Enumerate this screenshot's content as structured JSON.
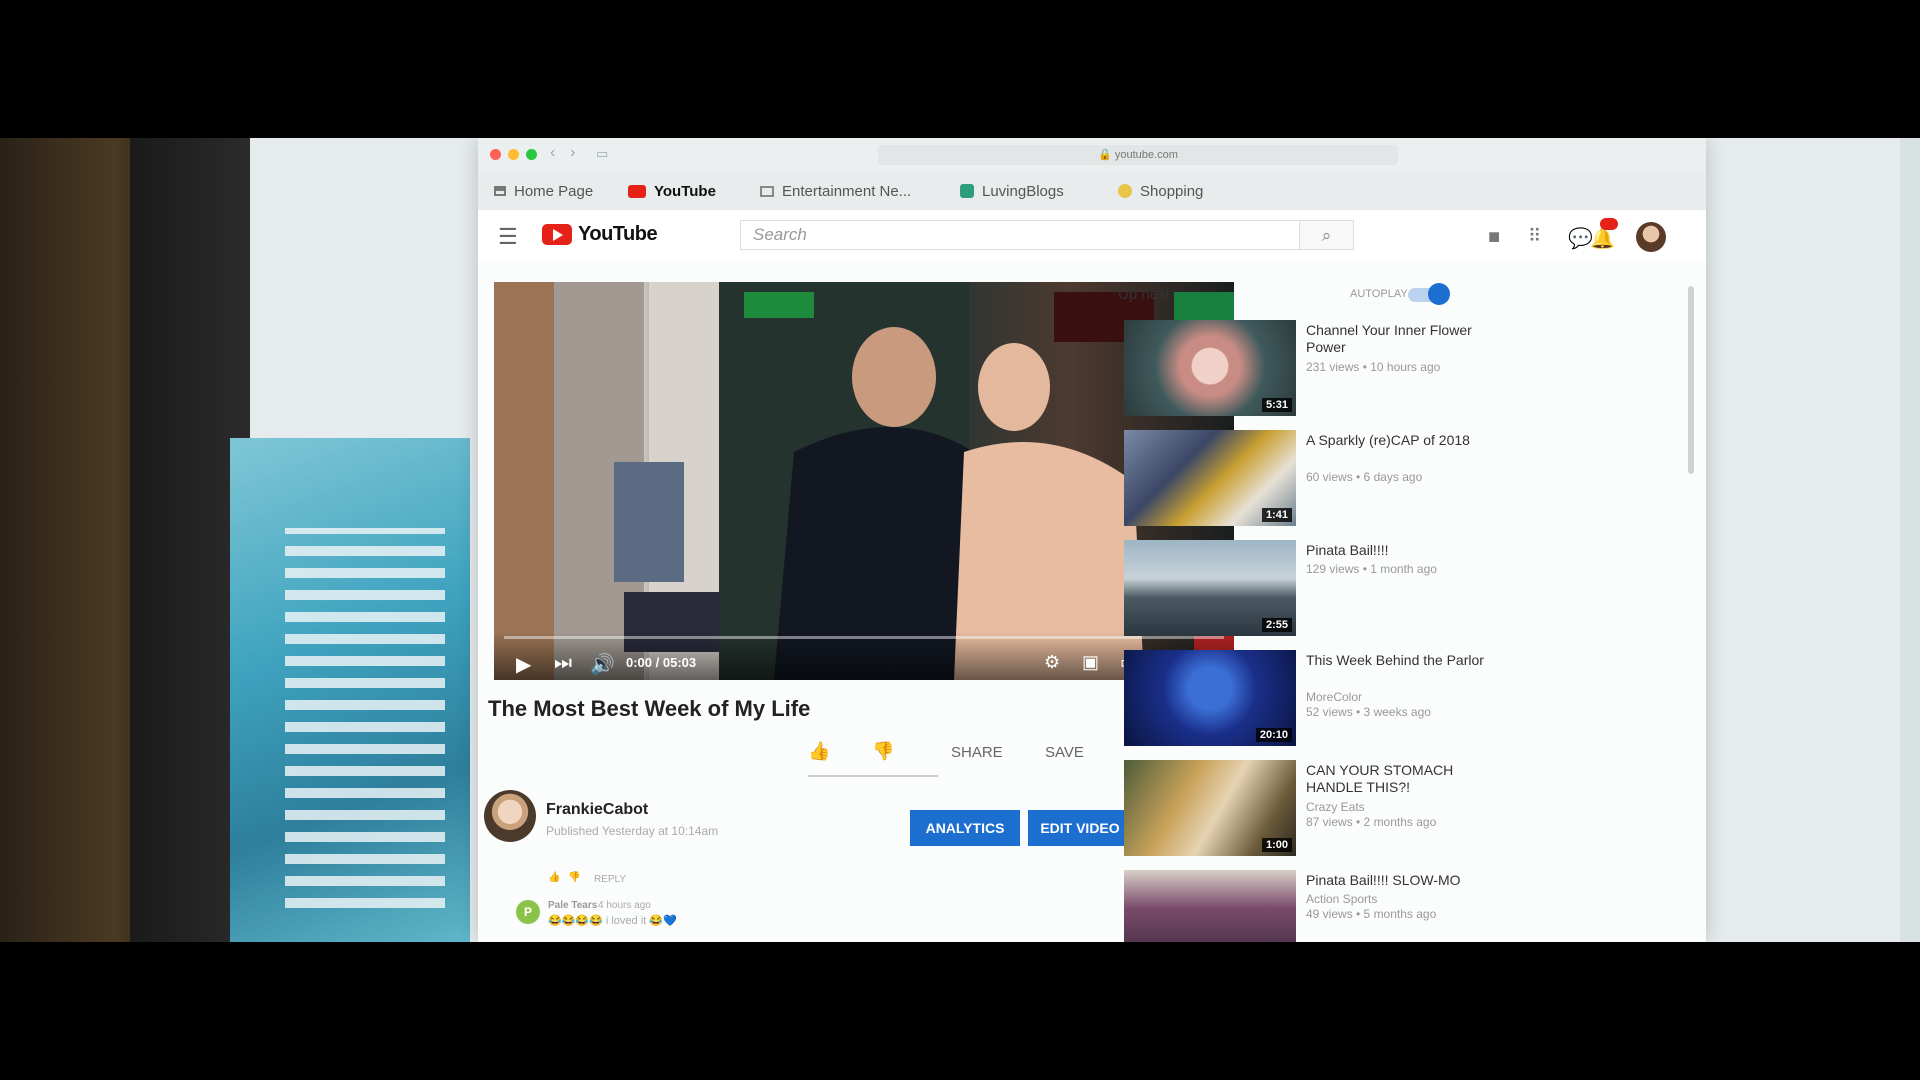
{
  "browser": {
    "url": "youtube.com",
    "tabs": [
      {
        "label": "Home Page",
        "icon": "home-icon"
      },
      {
        "label": "YouTube",
        "icon": "youtube-icon"
      },
      {
        "label": "Entertainment Ne...",
        "icon": "folder-icon"
      },
      {
        "label": "LuvingBlogs",
        "icon": "blog-icon"
      },
      {
        "label": "Shopping",
        "icon": "shopping-icon"
      }
    ]
  },
  "header": {
    "logo_text": "YouTube",
    "search_placeholder": "Search"
  },
  "player": {
    "time": "0:00 / 05:03",
    "progress": 0.0
  },
  "video": {
    "title": "The Most Best Week of My Life",
    "share_label": "SHARE",
    "save_label": "SAVE",
    "channel": "FrankieCabot",
    "published": "Published Yesterday at 10:14am",
    "analytics_label": "ANALYTICS",
    "edit_label": "EDIT VIDEO"
  },
  "comments": {
    "reply_label": "REPLY",
    "author": "Pale Tears",
    "time": "4 hours ago",
    "avatar_letter": "P",
    "text": "😂😂😂😂 i loved it 😂💙"
  },
  "sidebar": {
    "up_next": "Up next",
    "autoplay": "AUTOPLAY",
    "items": [
      {
        "title": "Channel Your Inner Flower Power",
        "channel": "",
        "views": "231 views • 10 hours ago",
        "duration": "5:31"
      },
      {
        "title": "A Sparkly (re)CAP of 2018",
        "channel": "",
        "views": "60 views • 6 days ago",
        "duration": "1:41"
      },
      {
        "title": "Pinata Bail!!!!",
        "channel": "",
        "views": "129 views • 1 month ago",
        "duration": "2:55"
      },
      {
        "title": "This Week Behind the Parlor",
        "channel": "MoreColor",
        "views": "52 views • 3 weeks ago",
        "duration": "20:10"
      },
      {
        "title": "CAN YOUR STOMACH HANDLE THIS?!",
        "channel": "Crazy Eats",
        "views": "87 views • 2 months ago",
        "duration": "1:00"
      },
      {
        "title": "Pinata Bail!!!! SLOW-MO",
        "channel": "Action Sports",
        "views": "49 views • 5 months ago",
        "duration": ""
      }
    ]
  },
  "colors": {
    "brand_red": "#e62117",
    "action_blue": "#1c6fcf"
  }
}
